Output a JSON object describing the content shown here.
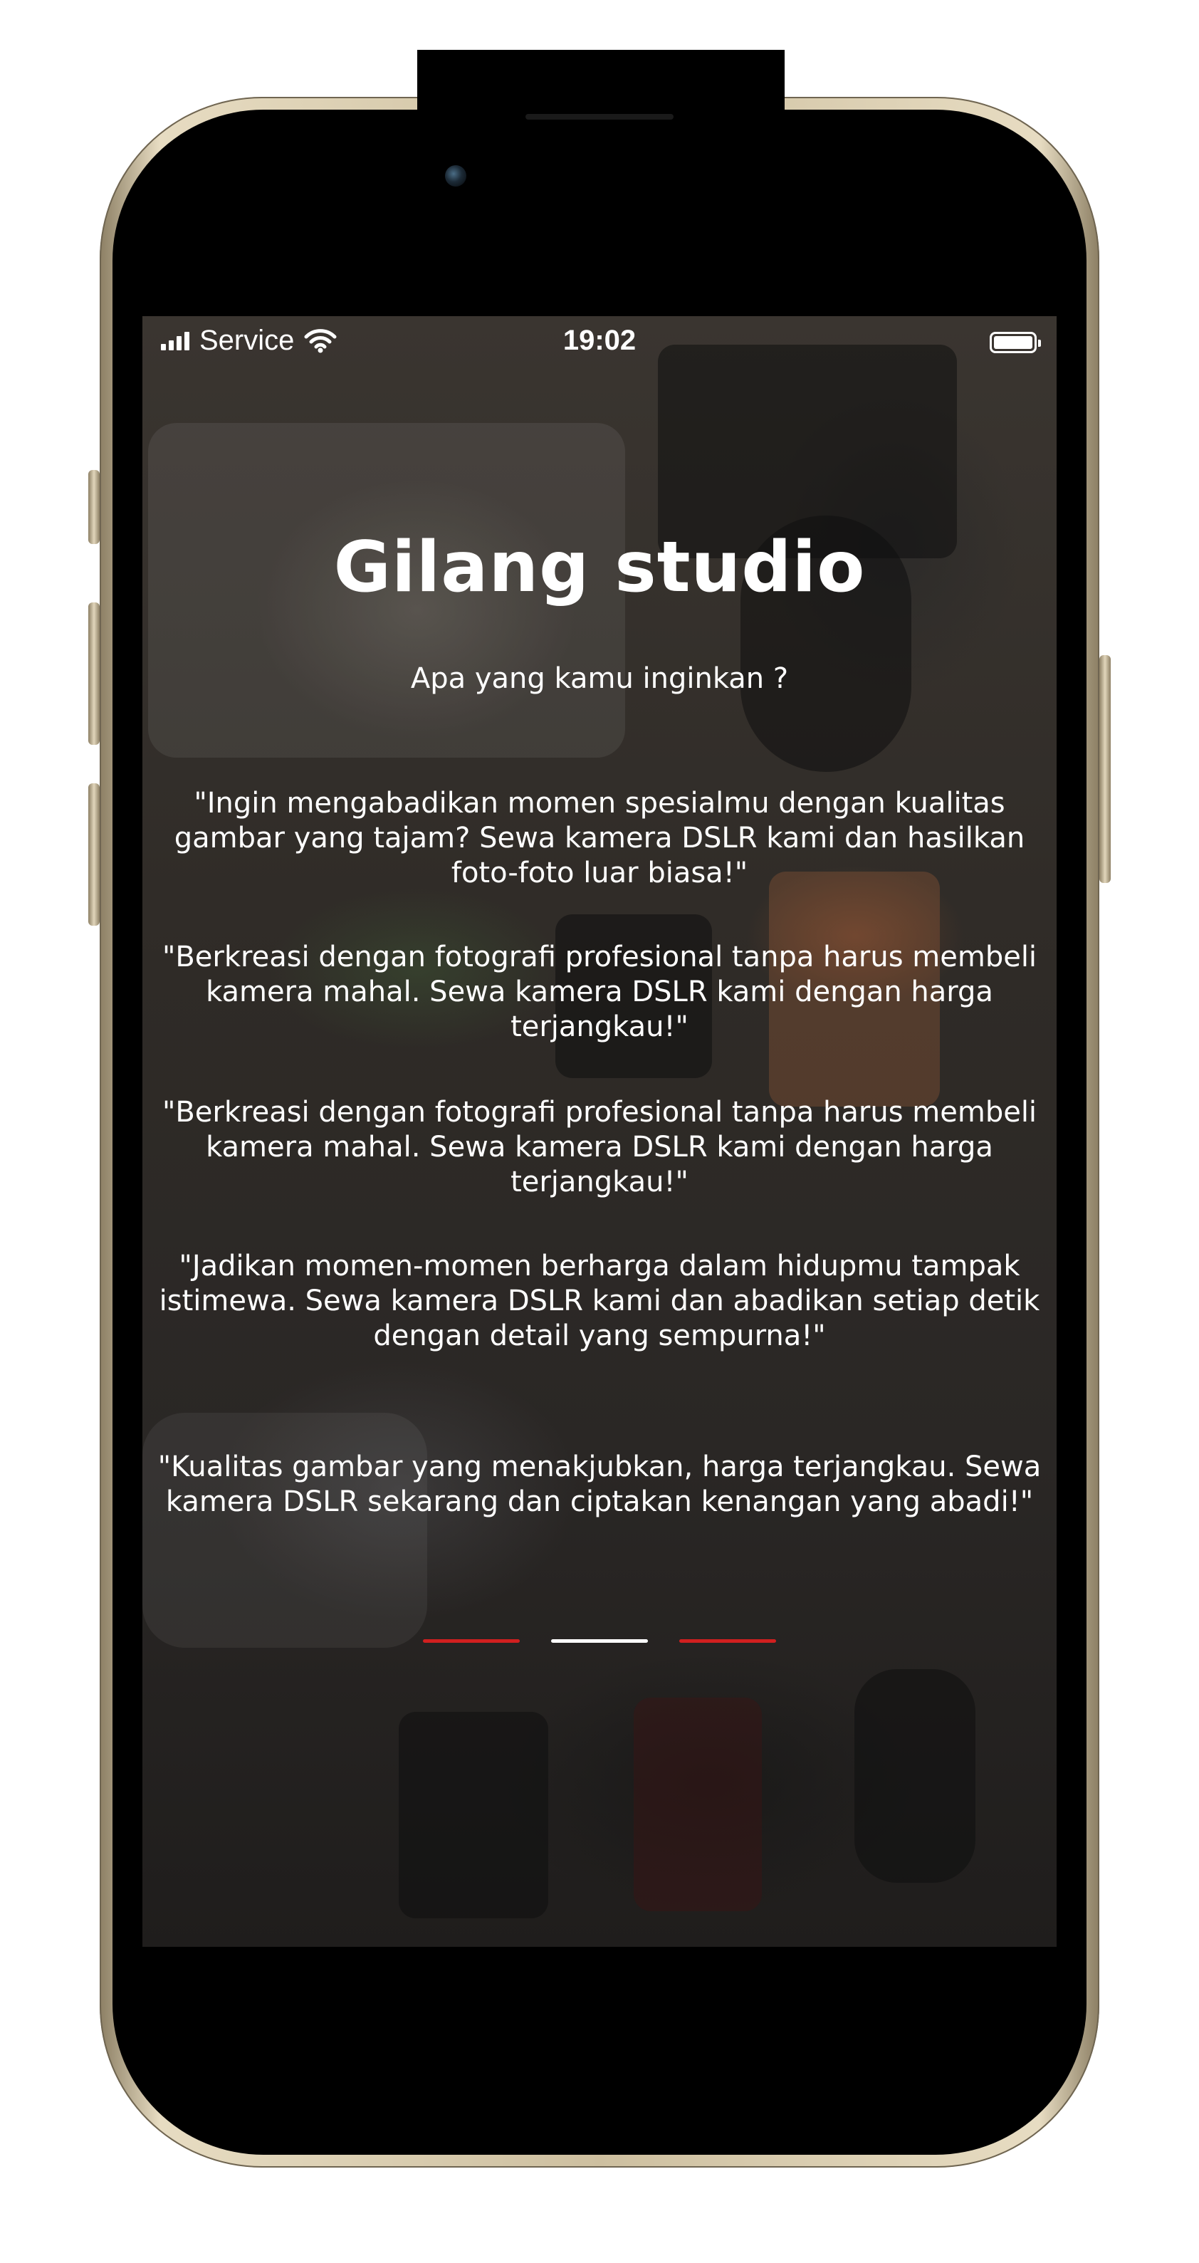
{
  "status_bar": {
    "carrier": "Service",
    "time": "19:02"
  },
  "app": {
    "title": "Gilang studio",
    "subtitle": "Apa yang kamu inginkan ?",
    "quotes": [
      "\"Ingin mengabadikan momen spesialmu dengan kualitas gambar yang tajam? Sewa kamera DSLR kami dan hasilkan foto-foto luar biasa!\"",
      "\"Berkreasi dengan fotografi profesional tanpa harus membeli kamera mahal. Sewa kamera DSLR kami dengan harga terjangkau!\"",
      "\"Berkreasi dengan fotografi profesional tanpa harus membeli kamera mahal. Sewa kamera DSLR kami dengan harga terjangkau!\"",
      "\"Jadikan momen-momen berharga dalam hidupmu tampak istimewa. Sewa kamera DSLR kami dan abadikan setiap detik dengan detail yang sempurna!\"",
      "\"Kualitas gambar yang menakjubkan, harga terjangkau. Sewa kamera DSLR sekarang dan ciptakan kenangan yang abadi!\""
    ]
  },
  "pager": {
    "count": 3,
    "active_index": 1,
    "active_color": "#ffffff",
    "inactive_color": "#d11f1f"
  },
  "icons": {
    "signal": "cellular-signal-icon",
    "wifi": "wifi-icon",
    "battery": "battery-icon"
  }
}
